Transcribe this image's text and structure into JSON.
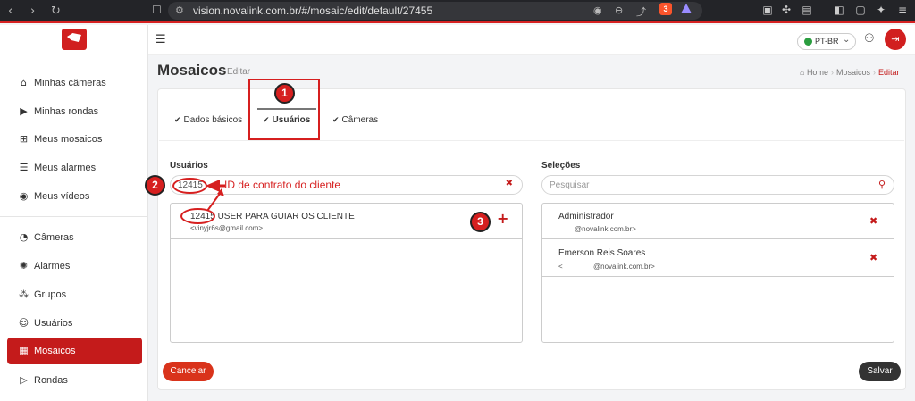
{
  "browser": {
    "url": "vision.novalink.com.br/#/mosaic/edit/default/27455",
    "ext_badge": "3"
  },
  "sidebar": {
    "items": [
      {
        "label": "Minhas câmeras",
        "icon": "home-icon"
      },
      {
        "label": "Minhas rondas",
        "icon": "play-square-icon"
      },
      {
        "label": "Meus mosaicos",
        "icon": "grid-icon"
      },
      {
        "label": "Meus alarmes",
        "icon": "alarm-icon"
      },
      {
        "label": "Meus vídeos",
        "icon": "play-circle-icon"
      },
      {
        "label": "Câmeras",
        "icon": "camera-icon"
      },
      {
        "label": "Alarmes",
        "icon": "siren-icon"
      },
      {
        "label": "Grupos",
        "icon": "groups-icon"
      },
      {
        "label": "Usuários",
        "icon": "users-icon"
      },
      {
        "label": "Mosaicos",
        "icon": "mosaic-icon",
        "active": true
      },
      {
        "label": "Rondas",
        "icon": "rounds-icon"
      }
    ]
  },
  "topbar": {
    "language": "PT-BR"
  },
  "header": {
    "title": "Mosaicos",
    "subtitle": "Editar",
    "breadcrumb": {
      "home": "Home",
      "section": "Mosaicos",
      "current": "Editar"
    }
  },
  "tabs": [
    {
      "label": "Dados básicos"
    },
    {
      "label": "Usuários",
      "active": true
    },
    {
      "label": "Câmeras"
    }
  ],
  "users_panel": {
    "label": "Usuários",
    "search_value": "12415",
    "results": [
      {
        "name": "12415 USER PARA GUIAR OS CLIENTE",
        "email": "<vinyjr6s@gmail.com>"
      }
    ]
  },
  "selections_panel": {
    "label": "Seleções",
    "search_placeholder": "Pesquisar",
    "items": [
      {
        "name": "Administrador",
        "email": "@novalink.com.br>"
      },
      {
        "name": "Emerson Reis Soares",
        "email_prefix": "<",
        "email": "@novalink.com.br>"
      }
    ]
  },
  "buttons": {
    "cancel": "Cancelar",
    "save": "Salvar"
  },
  "annotations": {
    "badge_1": "1",
    "badge_2": "2",
    "badge_3": "3",
    "text": "ID de contrato do cliente"
  },
  "colors": {
    "brand_red": "#c41b1b",
    "cancel": "#d9331b",
    "save": "#333333"
  }
}
